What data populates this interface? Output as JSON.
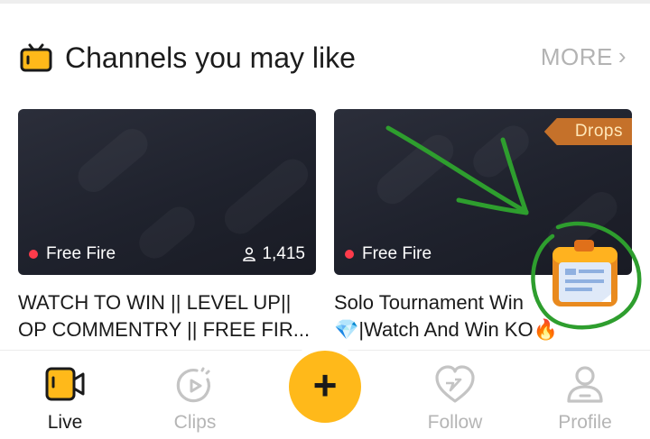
{
  "section": {
    "title": "Channels you may like",
    "more_label": "MORE"
  },
  "channels": [
    {
      "game": "Free Fire",
      "viewers": "1,415",
      "title_line1": "WATCH TO WIN || LEVEL UP||",
      "title_line2": "OP COMMENTRY || FREE FIR..."
    },
    {
      "game": "Free Fire",
      "badge": "Drops",
      "title_line1": "Solo Tournament Win",
      "title_line2": "💎|Watch And Win KO🔥"
    }
  ],
  "nav": {
    "live": "Live",
    "clips": "Clips",
    "follow": "Follow",
    "profile": "Profile",
    "create": "+"
  },
  "colors": {
    "accent": "#ffb91a",
    "live_dot": "#ff3b4b",
    "annotation": "#2e9e2e",
    "drops_badge": "#c5712a"
  },
  "icons": [
    "tv-icon",
    "chevron-right-icon",
    "user-icon",
    "treasure-chest-icon",
    "clipboard-icon",
    "video-camera-icon",
    "clips-icon",
    "plus-icon",
    "heart-icon",
    "profile-icon"
  ]
}
